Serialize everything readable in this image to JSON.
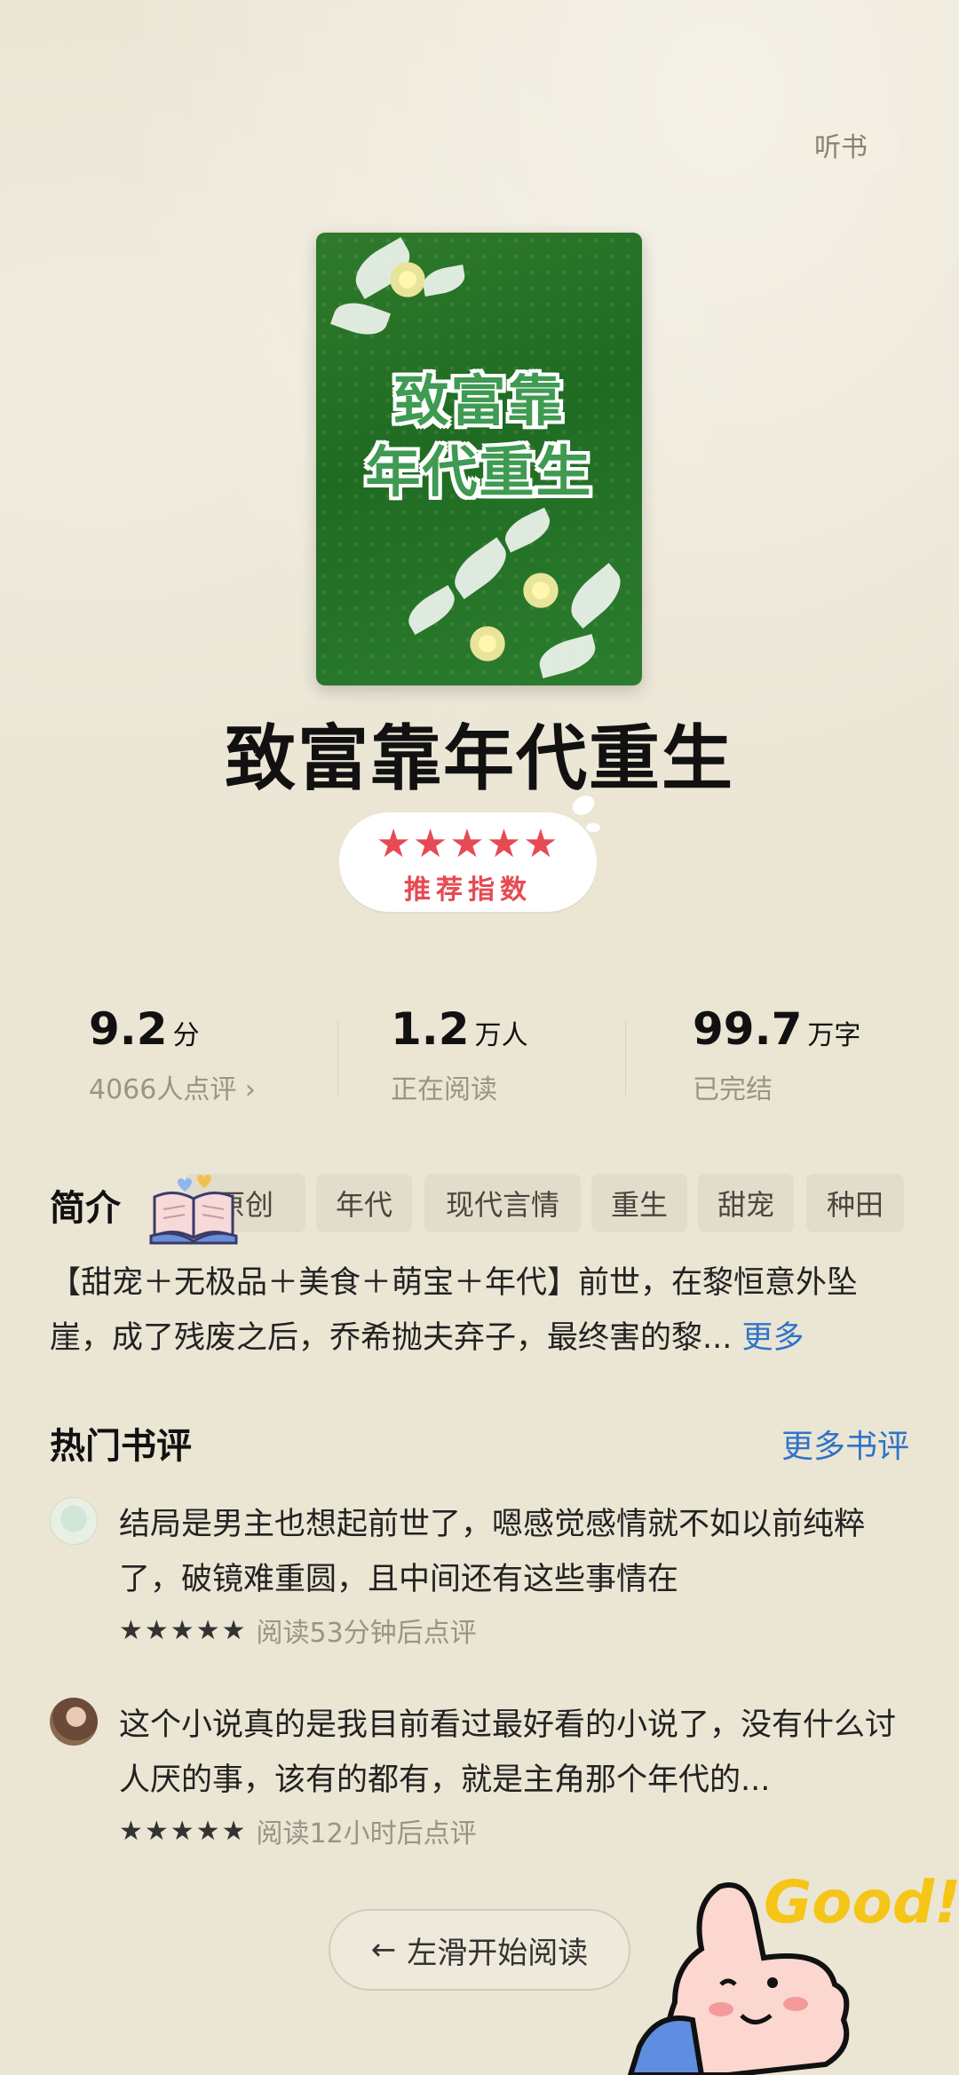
{
  "header": {
    "listen_label": "听书"
  },
  "cover": {
    "line1": "致富靠",
    "line2": "年代重生"
  },
  "book": {
    "title": "致富靠年代重生"
  },
  "recommend": {
    "stars": "★★★★★",
    "label": "推荐指数"
  },
  "stats": [
    {
      "value": "9.2",
      "unit": "分",
      "sub": "4066人点评 ›"
    },
    {
      "value": "1.2",
      "unit": "万人",
      "sub": "正在阅读"
    },
    {
      "value": "99.7",
      "unit": "万字",
      "sub": "已完结"
    }
  ],
  "intro": {
    "section_label": "简介",
    "tags": [
      "原创",
      "年代",
      "现代言情",
      "重生",
      "甜宠",
      "种田"
    ],
    "text": "【甜宠＋无极品＋美食＋萌宝＋年代】前世，在黎恒意外坠崖，成了残废之后，乔希抛夫弃子，最终害的黎...",
    "more_label": "更多"
  },
  "hot_reviews": {
    "title": "热门书评",
    "more_label": "更多书评",
    "items": [
      {
        "text": "结局是男主也想起前世了，嗯感觉感情就不如以前纯粹了，破镜难重圆，且中间还有这些事情在",
        "stars": "★★★★★",
        "meta": "阅读53分钟后点评"
      },
      {
        "text": "这个小说真的是我目前看过最好看的小说了，没有什么讨人厌的事，该有的都有，就是主角那个年代的...",
        "stars": "★★★★★",
        "meta": "阅读12小时后点评"
      }
    ]
  },
  "footer": {
    "start_label": "左滑开始阅读",
    "sticker_text": "Good!"
  },
  "colors": {
    "background": "#ebe5d4",
    "accent_red": "#e64a52",
    "link_blue": "#2f73c9",
    "cover_green": "#2f7a2b"
  }
}
